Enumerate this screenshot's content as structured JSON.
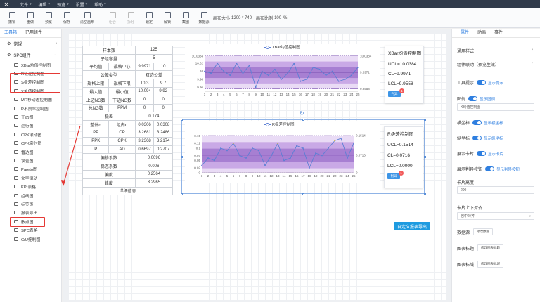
{
  "menu": [
    "文件",
    "编辑",
    "预览",
    "设置",
    "帮助"
  ],
  "toolbar": {
    "buttons": [
      "撤销",
      "重做",
      "预览",
      "保存",
      "清空画布",
      "组合",
      "拆分",
      "锁定",
      "解锁",
      "截图",
      "数据源"
    ],
    "canvas_size_label": "画布大小",
    "canvas_size_value": "1200 * 740",
    "canvas_scale_label": "画布比例",
    "canvas_scale_value": "100",
    "canvas_scale_unit": "%"
  },
  "left_panel": {
    "tabs": [
      "工具箱",
      "已用组件"
    ],
    "section_common": "常规",
    "section_spc": "SPC组件",
    "items": [
      "XBar均值控制图",
      "R极差控制图",
      "S极差控制图",
      "X单值控制图",
      "MR移动差控制图",
      "P不良率控制图",
      "正态图",
      "运行图",
      "CPK滚动图",
      "CPK实时图",
      "雷达图",
      "误差图",
      "Pareto图",
      "文字滚动",
      "KPI表格",
      "趋线图",
      "标签页",
      "报表导出",
      "散点图",
      "SPC表格",
      "C/U控制图"
    ]
  },
  "kpi_table": {
    "rows": [
      [
        "样本数",
        "125"
      ],
      [
        "子组容量",
        "5"
      ],
      [
        "平均值",
        "规格中心",
        "9.9971",
        "10"
      ],
      [
        "公差类型",
        "双边公差"
      ],
      [
        "规格上限",
        "规格下限",
        "10.3",
        "9.7"
      ],
      [
        "最大值",
        "最小值",
        "10.094",
        "9.92"
      ],
      [
        "上边NG数",
        "下边NG数",
        "0",
        "0"
      ],
      [
        "总NG数",
        "PPM",
        "0",
        "0"
      ],
      [
        "极差",
        "0.174"
      ],
      [
        "整体σ",
        "组内σ",
        "0.0306",
        "0.0308"
      ],
      [
        "PP",
        "CP",
        "3.2681",
        "3.2486"
      ],
      [
        "PPK",
        "CPK",
        "3.2368",
        "3.2174"
      ],
      [
        "P",
        "AD",
        "0.6697",
        "0.2707"
      ],
      [
        "偏移系数",
        "0.0096"
      ],
      [
        "稳态系数",
        "0.006"
      ],
      [
        "偏度",
        "0.2564"
      ],
      [
        "峰度",
        "3.2965"
      ],
      [
        "详细信息"
      ]
    ]
  },
  "xbar_chart": {
    "legend": "XBar均值控制图",
    "info_title": "XBar均值控制图",
    "ucl_label": "UCL=10.0384",
    "cl_label": "CL=9.9971",
    "lcl_label": "LCL=9.9558",
    "button": "判异",
    "badge": "1"
  },
  "r_chart": {
    "legend": "R极差控制图",
    "info_title": "R极差控制图",
    "ucl_label": "UCL=0.1514",
    "cl_label": "CL=0.0716",
    "lcl_label": "LCL=0.0000",
    "button": "判异",
    "badge": "1"
  },
  "export_button": "自定义报表导出",
  "right_panel": {
    "tabs": [
      "属性",
      "动画",
      "事件"
    ],
    "general_style": "通用样式",
    "component_link": "组件联动（预览生效）",
    "tool_tip": {
      "label": "工具提示",
      "toggle_label": "显示提示"
    },
    "legend": {
      "label": "图例",
      "toggle_label": "显示图例"
    },
    "legend_input": "X均值控制图",
    "x_axis": {
      "label": "横坐标",
      "toggle_label": "显示横坐标"
    },
    "y_axis": {
      "label": "纵坐标",
      "toggle_label": "显示纵坐标"
    },
    "card": {
      "label": "展示卡片",
      "toggle_label": "显示卡片"
    },
    "judge_btn": {
      "label": "展示判异按钮",
      "toggle_label": "显示判异按钮"
    },
    "card_height_label": "卡片高度",
    "card_height_value": "200",
    "card_align_label": "卡片上下对齐",
    "card_align_value": "居中对齐",
    "datasource_label": "数据源",
    "datasource_btn": "修改数据",
    "chart_title_label": "图表标题",
    "chart_title_btn": "修改图表标题",
    "chart_label_label": "图表标域",
    "chart_label_btn": "修改图表标域"
  },
  "chart_data": [
    {
      "type": "line",
      "title": "XBar均值控制图",
      "x": [
        1,
        2,
        3,
        4,
        5,
        6,
        7,
        8,
        9,
        10,
        11,
        12,
        13,
        14,
        15,
        16,
        17,
        18,
        19,
        20,
        21,
        22,
        23,
        24,
        25
      ],
      "series": [
        {
          "name": "XBar均值控制图",
          "values": [
            10.0,
            9.995,
            10.02,
            10.0,
            9.99,
            10.02,
            9.995,
            10.015,
            9.96,
            10.0,
            9.99,
            10.005,
            9.98,
            9.995,
            10.02,
            9.975,
            9.98,
            10.01,
            10.005,
            9.99,
            10.0,
            9.975,
            9.98,
            9.99,
            10.01
          ]
        }
      ],
      "y_ticks": [
        "10.0384",
        "10.02",
        "10",
        "9.98",
        "9.96"
      ],
      "right_labels": [
        "10.0384",
        "9.9971",
        "9.9558"
      ],
      "ucl": 10.0384,
      "cl": 9.9971,
      "lcl": 9.9558,
      "ylim": [
        9.95,
        10.045
      ]
    },
    {
      "type": "line",
      "title": "R极差控制图",
      "x": [
        1,
        2,
        3,
        4,
        5,
        6,
        7,
        8,
        9,
        10,
        11,
        12,
        13,
        14,
        15,
        16,
        17,
        18,
        19,
        20,
        21,
        22,
        23,
        24,
        25
      ],
      "series": [
        {
          "name": "R极差控制图",
          "values": [
            0.03,
            0.06,
            0.05,
            0.1,
            0.09,
            0.12,
            0.07,
            0.06,
            0.1,
            0.09,
            0.03,
            0.07,
            0.12,
            0.05,
            0.06,
            0.11,
            0.1,
            0.02,
            0.08,
            0.07,
            0.1,
            0.13,
            0.14,
            0.06,
            0.12
          ]
        }
      ],
      "y_ticks": [
        "0.15",
        "0.12",
        "0.1",
        "0.07",
        "0.05",
        "0.02",
        "0"
      ],
      "right_labels": [
        "0.1514",
        "0.0716",
        "0"
      ],
      "ucl": 0.1514,
      "cl": 0.0716,
      "lcl": 0,
      "ylim": [
        0,
        0.16
      ]
    }
  ]
}
